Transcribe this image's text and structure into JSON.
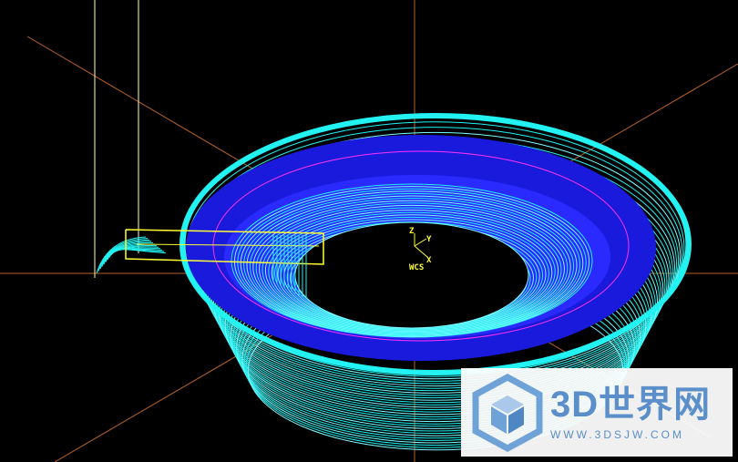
{
  "viewport": {
    "background": "#000000",
    "wcs": {
      "z_label": "Z",
      "y_label": "Y",
      "x_label": "X",
      "wcs_label": "WCS",
      "color": "#ffff33"
    }
  },
  "colors": {
    "axis_lines": "#b8612a",
    "toolpath_outer": "#22f2f2",
    "toolpath_mid": "#7ffaff",
    "part_surface": "#1a1add",
    "part_highlight": "#2a2aff",
    "boundary": "#ff33ff",
    "tool_path": "#ffff33",
    "tool_holder": "#ffffaa"
  },
  "watermark": {
    "title": "3D世界网",
    "url": "WWW.3DSJW.COM",
    "logo_icon": "cube-icon",
    "text_color": "#5b8fc9",
    "logo_color": "#6fa3d8"
  }
}
